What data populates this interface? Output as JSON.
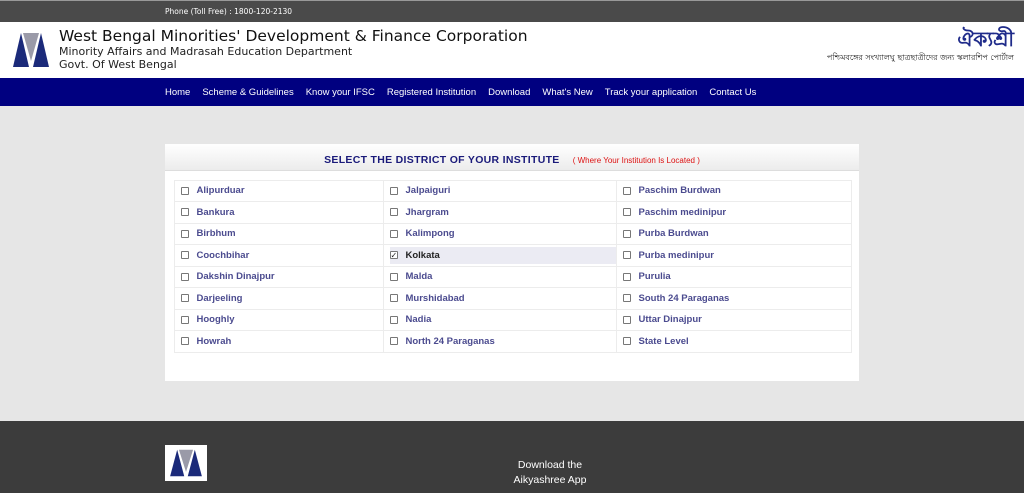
{
  "topbar": {
    "phone": "Phone (Toll Free) : 1800-120-2130"
  },
  "header": {
    "title": "West Bengal Minorities' Development & Finance Corporation",
    "subtitle_1": "Minority Affairs and Madrasah Education Department",
    "subtitle_2": "Govt. Of West Bengal",
    "brand_name": "ঐক্যশ্রী",
    "brand_tagline": "পশ্চিমবঙ্গের সংখ্যালঘু ছাত্রছাত্রীদের জন্য স্কলারশিপ পোর্টাল"
  },
  "nav": {
    "items": [
      "Home",
      "Scheme & Guidelines",
      "Know your IFSC",
      "Registered Institution",
      "Download",
      "What's New",
      "Track your application",
      "Contact Us"
    ]
  },
  "panel": {
    "title": "SELECT THE DISTRICT OF YOUR INSTITUTE",
    "note": "( Where Your Institution Is Located )"
  },
  "districts": {
    "col1": [
      "Alipurduar",
      "Bankura",
      "Birbhum",
      "Coochbihar",
      "Dakshin Dinajpur",
      "Darjeeling",
      "Hooghly",
      "Howrah"
    ],
    "col2": [
      "Jalpaiguri",
      "Jhargram",
      "Kalimpong",
      "Kolkata",
      "Malda",
      "Murshidabad",
      "Nadia",
      "North 24 Paraganas"
    ],
    "col3": [
      "Paschim Burdwan",
      "Paschim medinipur",
      "Purba Burdwan",
      "Purba medinipur",
      "Purulia",
      "South 24 Paraganas",
      "Uttar Dinajpur",
      "State Level"
    ],
    "selected": "Kolkata"
  },
  "footer": {
    "download_line_1": "Download the",
    "download_line_2": "Aikyashree App"
  },
  "colors": {
    "nav_bg": "#000080",
    "district_text": "#4b4b8f",
    "note_red": "#dd1111",
    "footer_bg": "#3c3c3c"
  }
}
